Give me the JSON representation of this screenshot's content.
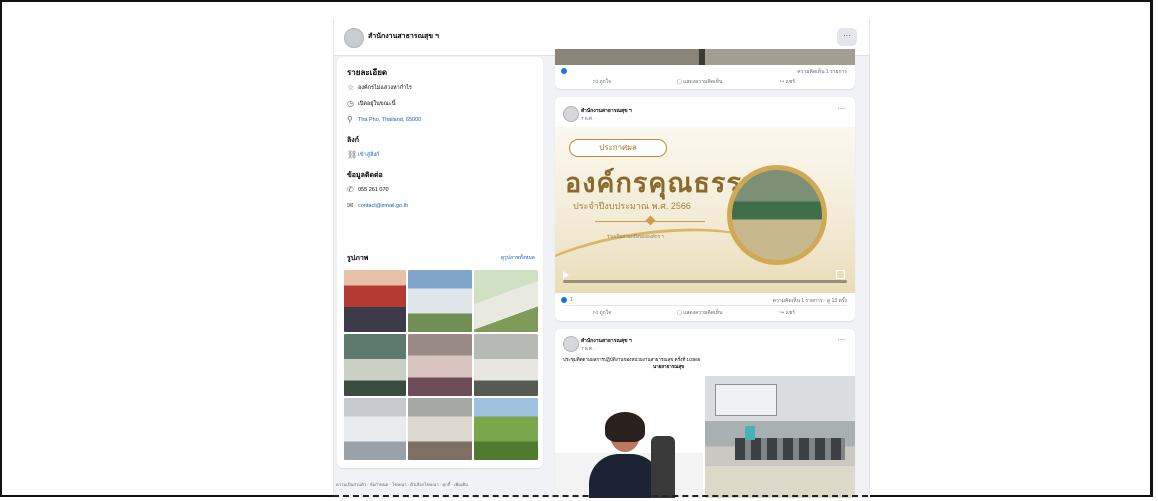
{
  "page": {
    "name": "สำนักงานสาธารณสุข ฯ",
    "more": "···"
  },
  "intro": {
    "title": "รายละเอียด",
    "category": "องค์กรไม่แสวงหากำไร",
    "hours": "เปิดอยู่ในขณะนี้",
    "address": "Tha Pho, Thailand, 65000",
    "website_heading": "ลิงก์",
    "website": "เข้าสู่ลิงก์",
    "contact_heading": "ข้อมูลติดต่อ",
    "phone": "055 261 070",
    "email": "contact@email.go.th"
  },
  "photos": {
    "title": "รูปภาพ",
    "see_all": "ดูรูปภาพทั้งหมด"
  },
  "footer": "ความเป็นส่วนตัว · ข้อกำหนด · โฆษณา · ตัวเลือกโฆษณา · คุกกี้ · เพิ่มเติม",
  "post0": {
    "like": "ถูกใจ",
    "comment": "แสดงความคิดเห็น",
    "share": "แชร์",
    "stats": "ความคิดเห็น 1 รายการ"
  },
  "post1": {
    "author": "สำนักงานสาธารณสุข ฯ",
    "time": "7 พ.ศ. ·",
    "banner_tag": "ประกาศผล",
    "banner_title": "องค์กรคุณธรรม",
    "banner_sub": "ประจำปีงบประมาณ พ.ศ. 2566",
    "banner_small": "ร่วมเป็นส่วนหนึ่งขององค์กร ฯ",
    "reactions": "1",
    "stats": "ความคิดเห็น 1 รายการ · ดู 13 ครั้ง",
    "like": "ถูกใจ",
    "comment": "แสดงความคิดเห็น",
    "share": "แชร์"
  },
  "post2": {
    "author": "สำนักงานสาธารณสุข ฯ",
    "time": "7 พ.ศ. ·",
    "text": "ประชุมติดตามผลการปฏิบัติงานของหน่วยงานสาธารณสุข ครั้งที่ 1/2566",
    "text2": "นายสาธารณสุข"
  },
  "colors": {
    "accent": "#1b5fc1",
    "gold": "#c9a04a",
    "bg": "#f0f2f5"
  }
}
